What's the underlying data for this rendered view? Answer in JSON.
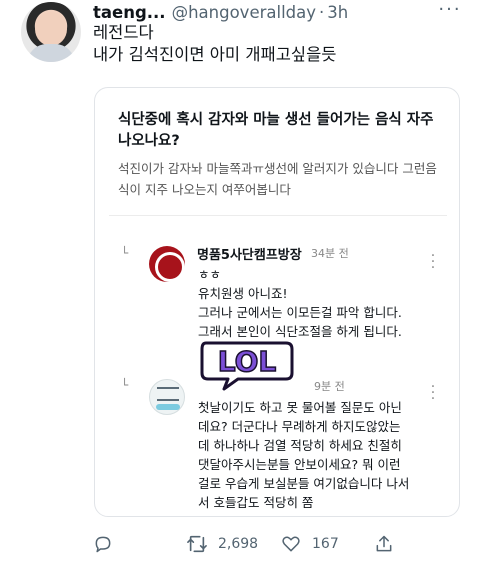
{
  "tweet": {
    "display_name": "taeng...",
    "handle": "@hangoverallday",
    "separator": "·",
    "time": "3h",
    "more_label": "···",
    "lines": [
      "레전드다",
      "내가 김석진이면 아미 개패고싶을듯"
    ]
  },
  "embedded": {
    "question_title": "식단중에 혹시 감자와 마늘 생선 들어가는 음식 자주 나오나요?",
    "question_body": "석진이가 감자놔 마늘쪽과ㅠ생선에 알러지가 있습니다  그런음식이 지주 나오는지 여쭈어봅니다",
    "reply_marker": "└",
    "comments": [
      {
        "name": "명품5사단캠프방장",
        "time": "34분 전",
        "lines": [
          "ㅎㅎ",
          "유치원생 아니죠!",
          "그러나 군에서는 이모든걸 파악 합니다.",
          "그래서 본인이 식단조절을 하게 됩니다."
        ]
      },
      {
        "name": "",
        "time": "9분 전",
        "lines": [
          "첫날이기도 하고 못 물어볼 질문도 아닌",
          "데요? 더군다나 무례하게 하지도않았는",
          "데 하나하나 검열 적당히 하세요 친절히",
          "댓달아주시는분들 안보이세요? 뭐 이런",
          "걸로 우습게 보실분들 여기없습니다 나서",
          "서 호들갑도 적당히 쫌"
        ]
      }
    ],
    "sticker_text": "LOL"
  },
  "actions": {
    "retweets": "2,698",
    "likes": "167"
  },
  "colors": {
    "text": "#0f1419",
    "secondary": "#536471",
    "sticker_fill": "#7b4fd6",
    "sticker_outline": "#1a1030"
  }
}
